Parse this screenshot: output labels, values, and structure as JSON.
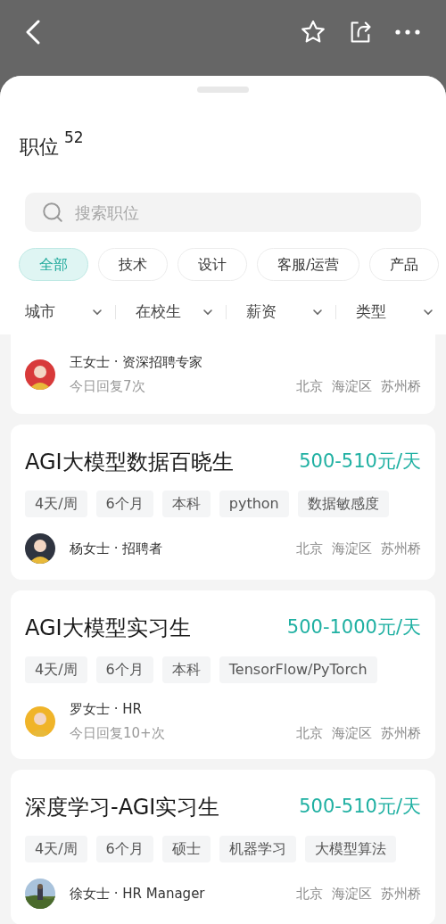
{
  "header": {
    "buttons": [
      {
        "kind": "back"
      },
      {
        "kind": "star"
      },
      {
        "kind": "share"
      },
      {
        "kind": "more"
      }
    ]
  },
  "title": "职位",
  "count": "52",
  "search": {
    "placeholder": "搜索职位"
  },
  "categories": [
    {
      "label": "全部",
      "selected": true
    },
    {
      "label": "技术",
      "selected": false
    },
    {
      "label": "设计",
      "selected": false
    },
    {
      "label": "客服/运营",
      "selected": false
    },
    {
      "label": "产品",
      "selected": false
    }
  ],
  "filters": [
    "城市",
    "在校生",
    "薪资",
    "类型"
  ],
  "jobs": [
    {
      "recruiter": "王女士 · 资深招聘专家",
      "reply": "今日回复7次",
      "location": [
        "北京",
        "海淀区",
        "苏州桥"
      ],
      "avatar": {
        "kind": "figure"
      }
    },
    {
      "title": "AGI大模型数据百晓生",
      "salary": "500-510元/天",
      "tags": [
        "4天/周",
        "6个月",
        "本科",
        "python",
        "数据敏感度"
      ],
      "recruiter": "杨女士 · 招聘者",
      "location": [
        "北京",
        "海淀区",
        "苏州桥"
      ],
      "avatar": {
        "kind": "figure"
      }
    },
    {
      "title": "AGI大模型实习生",
      "salary": "500-1000元/天",
      "tags": [
        "4天/周",
        "6个月",
        "本科",
        "TensorFlow/PyTorch"
      ],
      "recruiter": "罗女士 · HR",
      "reply": "今日回复10+次",
      "location": [
        "北京",
        "海淀区",
        "苏州桥"
      ],
      "avatar": {
        "kind": "figure"
      }
    },
    {
      "title": "深度学习-AGI实习生",
      "salary": "500-510元/天",
      "tags": [
        "4天/周",
        "6个月",
        "硕士",
        "机器学习",
        "大模型算法"
      ],
      "recruiter": "徐女士 · HR Manager",
      "location": [
        "北京",
        "海淀区",
        "苏州桥"
      ],
      "avatar": {
        "kind": "picture"
      }
    }
  ]
}
